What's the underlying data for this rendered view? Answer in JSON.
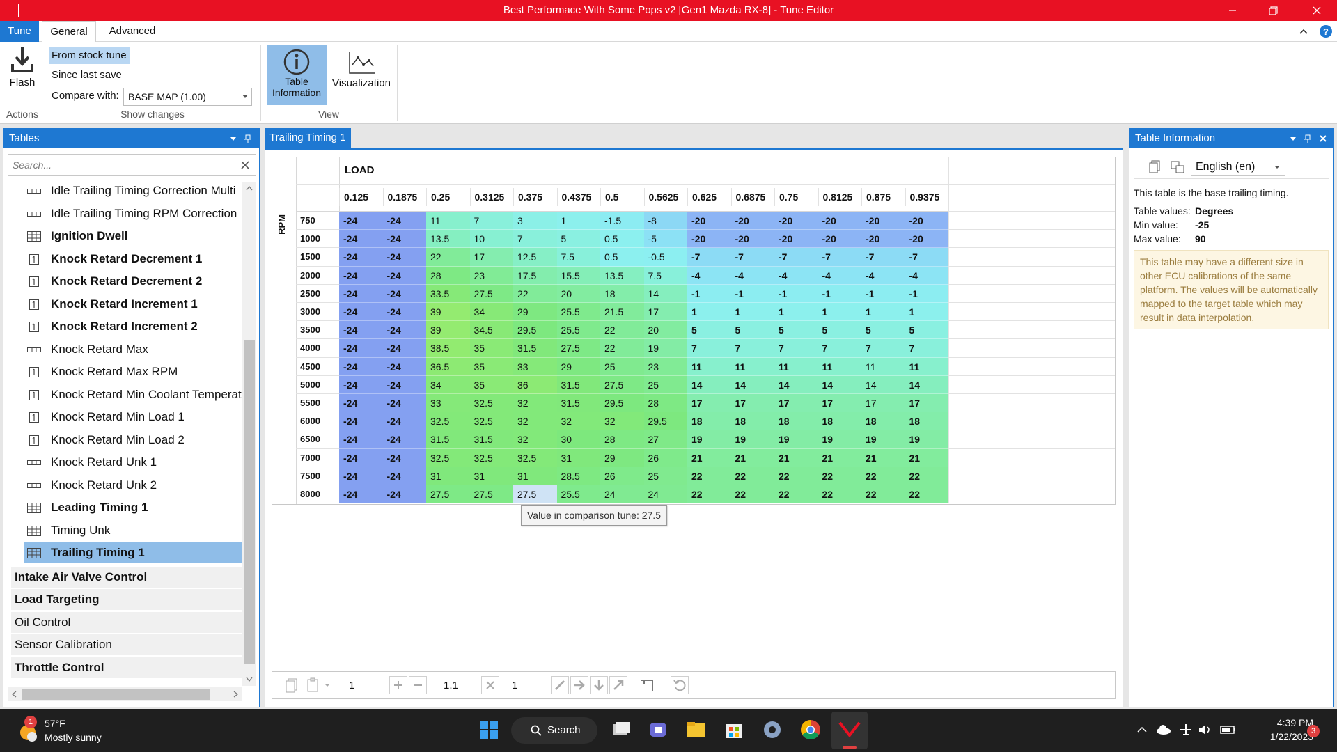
{
  "window": {
    "title": "Best Performace With Some Pops v2 [Gen1 Mazda RX-8] - Tune Editor"
  },
  "ribbon": {
    "tabs": {
      "tune": "Tune",
      "general": "General",
      "advanced": "Advanced"
    },
    "flash_label": "Flash",
    "actions_group": "Actions",
    "from_stock": "From stock tune",
    "since_last_save": "Since last save",
    "compare_label": "Compare with:",
    "compare_value": "BASE MAP (1.00)",
    "show_changes_group": "Show changes",
    "table_info_label1": "Table",
    "table_info_label2": "Information",
    "visualization_label": "Visualization",
    "view_group": "View"
  },
  "sidebar": {
    "title": "Tables",
    "search_placeholder": "Search...",
    "items": [
      {
        "label": "Idle Trailing Timing Correction Multi",
        "icon": "row-icon",
        "bold": false
      },
      {
        "label": "Idle Trailing Timing RPM Correction",
        "icon": "row-icon",
        "bold": false
      },
      {
        "label": "Ignition Dwell",
        "icon": "grid-icon",
        "bold": true
      },
      {
        "label": "Knock Retard Decrement 1",
        "icon": "scalar-icon",
        "bold": true
      },
      {
        "label": "Knock Retard Decrement 2",
        "icon": "scalar-icon",
        "bold": true
      },
      {
        "label": "Knock Retard Increment 1",
        "icon": "scalar-icon",
        "bold": true
      },
      {
        "label": "Knock Retard Increment 2",
        "icon": "scalar-icon",
        "bold": true
      },
      {
        "label": "Knock Retard Max",
        "icon": "row-icon",
        "bold": false
      },
      {
        "label": "Knock Retard Max RPM",
        "icon": "scalar-icon",
        "bold": false
      },
      {
        "label": "Knock Retard Min Coolant Temperatu",
        "icon": "scalar-icon",
        "bold": false
      },
      {
        "label": "Knock Retard Min Load 1",
        "icon": "scalar-icon",
        "bold": false
      },
      {
        "label": "Knock Retard Min Load 2",
        "icon": "scalar-icon",
        "bold": false
      },
      {
        "label": "Knock Retard Unk 1",
        "icon": "row-icon",
        "bold": false
      },
      {
        "label": "Knock Retard Unk 2",
        "icon": "row-icon",
        "bold": false
      },
      {
        "label": "Leading Timing 1",
        "icon": "grid-icon",
        "bold": true
      },
      {
        "label": "Timing Unk",
        "icon": "grid-icon",
        "bold": false
      },
      {
        "label": "Trailing Timing 1",
        "icon": "grid-icon",
        "bold": true,
        "selected": true
      }
    ],
    "groups": [
      {
        "label": "Intake Air Valve Control",
        "bold": true
      },
      {
        "label": "Load Targeting",
        "bold": true
      },
      {
        "label": "Oil Control",
        "bold": false
      },
      {
        "label": "Sensor Calibration",
        "bold": false
      },
      {
        "label": "Throttle Control",
        "bold": true
      }
    ]
  },
  "editor": {
    "tab_title": "Trailing Timing 1",
    "x_axis_title": "LOAD",
    "y_axis_title": "RPM",
    "columns": [
      "0.125",
      "0.1875",
      "0.25",
      "0.3125",
      "0.375",
      "0.4375",
      "0.5",
      "0.5625",
      "0.625",
      "0.6875",
      "0.75",
      "0.8125",
      "0.875",
      "0.9375"
    ],
    "rows": [
      {
        "rpm": "750",
        "v": [
          "-24",
          "-24",
          "11",
          "7",
          "3",
          "1",
          "-1.5",
          "-8",
          "-20",
          "-20",
          "-20",
          "-20",
          "-20",
          "-20"
        ]
      },
      {
        "rpm": "1000",
        "v": [
          "-24",
          "-24",
          "13.5",
          "10",
          "7",
          "5",
          "0.5",
          "-5",
          "-20",
          "-20",
          "-20",
          "-20",
          "-20",
          "-20"
        ]
      },
      {
        "rpm": "1500",
        "v": [
          "-24",
          "-24",
          "22",
          "17",
          "12.5",
          "7.5",
          "0.5",
          "-0.5",
          "-7",
          "-7",
          "-7",
          "-7",
          "-7",
          "-7"
        ]
      },
      {
        "rpm": "2000",
        "v": [
          "-24",
          "-24",
          "28",
          "23",
          "17.5",
          "15.5",
          "13.5",
          "7.5",
          "-4",
          "-4",
          "-4",
          "-4",
          "-4",
          "-4"
        ]
      },
      {
        "rpm": "2500",
        "v": [
          "-24",
          "-24",
          "33.5",
          "27.5",
          "22",
          "20",
          "18",
          "14",
          "-1",
          "-1",
          "-1",
          "-1",
          "-1",
          "-1"
        ]
      },
      {
        "rpm": "3000",
        "v": [
          "-24",
          "-24",
          "39",
          "34",
          "29",
          "25.5",
          "21.5",
          "17",
          "1",
          "1",
          "1",
          "1",
          "1",
          "1"
        ]
      },
      {
        "rpm": "3500",
        "v": [
          "-24",
          "-24",
          "39",
          "34.5",
          "29.5",
          "25.5",
          "22",
          "20",
          "5",
          "5",
          "5",
          "5",
          "5",
          "5"
        ]
      },
      {
        "rpm": "4000",
        "v": [
          "-24",
          "-24",
          "38.5",
          "35",
          "31.5",
          "27.5",
          "22",
          "19",
          "7",
          "7",
          "7",
          "7",
          "7",
          "7"
        ]
      },
      {
        "rpm": "4500",
        "v": [
          "-24",
          "-24",
          "36.5",
          "35",
          "33",
          "29",
          "25",
          "23",
          "11",
          "11",
          "11",
          "11",
          "11",
          "11"
        ]
      },
      {
        "rpm": "5000",
        "v": [
          "-24",
          "-24",
          "34",
          "35",
          "36",
          "31.5",
          "27.5",
          "25",
          "14",
          "14",
          "14",
          "14",
          "14",
          "14"
        ]
      },
      {
        "rpm": "5500",
        "v": [
          "-24",
          "-24",
          "33",
          "32.5",
          "32",
          "31.5",
          "29.5",
          "28",
          "17",
          "17",
          "17",
          "17",
          "17",
          "17"
        ]
      },
      {
        "rpm": "6000",
        "v": [
          "-24",
          "-24",
          "32.5",
          "32.5",
          "32",
          "32",
          "32",
          "29.5",
          "18",
          "18",
          "18",
          "18",
          "18",
          "18"
        ]
      },
      {
        "rpm": "6500",
        "v": [
          "-24",
          "-24",
          "31.5",
          "31.5",
          "32",
          "30",
          "28",
          "27",
          "19",
          "19",
          "19",
          "19",
          "19",
          "19"
        ]
      },
      {
        "rpm": "7000",
        "v": [
          "-24",
          "-24",
          "32.5",
          "32.5",
          "32.5",
          "31",
          "29",
          "26",
          "21",
          "21",
          "21",
          "21",
          "21",
          "21"
        ]
      },
      {
        "rpm": "7500",
        "v": [
          "-24",
          "-24",
          "31",
          "31",
          "31",
          "28.5",
          "26",
          "25",
          "22",
          "22",
          "22",
          "22",
          "22",
          "22"
        ]
      },
      {
        "rpm": "8000",
        "v": [
          "-24",
          "-24",
          "27.5",
          "27.5",
          "27.5",
          "25.5",
          "24",
          "24",
          "22",
          "22",
          "22",
          "22",
          "22",
          "22"
        ]
      }
    ],
    "tooltip": "Value in comparison tune: 27.5",
    "toolbar": {
      "field1": "1",
      "field2": "1.1",
      "field3": "1"
    }
  },
  "info_panel": {
    "title": "Table Information",
    "language": "English (en)",
    "description": "This table is the base trailing timing.",
    "values_label": "Table values:",
    "values_value": "Degrees",
    "min_label": "Min value:",
    "min_value": "-25",
    "max_label": "Max value:",
    "max_value": "90",
    "note": "This table may have a different size in other ECU calibrations of the same platform. The values will be automatically mapped to the target table which may result in data interpolation."
  },
  "taskbar": {
    "weather_temp": "57°F",
    "weather_desc": "Mostly sunny",
    "weather_badge": "1",
    "search_label": "Search",
    "time": "4:39 PM",
    "date": "1/22/2023",
    "notif_count": "3"
  },
  "colors": {
    "accent": "#1e78d2",
    "titlebar": "#e81123"
  }
}
